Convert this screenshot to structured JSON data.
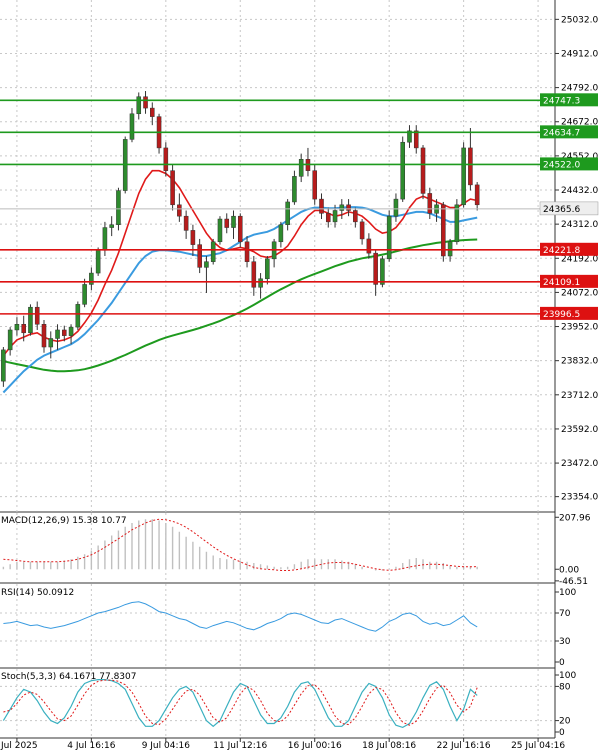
{
  "chart_data": {
    "type": "candlestick",
    "instrument_panel": {
      "price_ticks": [
        "25032.0",
        "24912.0",
        "24792.0",
        "24672.0",
        "24552.0",
        "24432.0",
        "24312.0",
        "24192.0",
        "24072.0",
        "23952.0",
        "23832.0",
        "23712.0",
        "23592.0",
        "23472.0",
        "23354.0"
      ],
      "price_tick_values": [
        25032,
        24912,
        24792,
        24672,
        24552,
        24432,
        24312,
        24192,
        24072,
        23952,
        23832,
        23712,
        23592,
        23472,
        23354
      ],
      "ylim": [
        23300,
        25100
      ],
      "levels": [
        {
          "label": "24747.3",
          "value": 24747.3,
          "color": "#1e9a1e"
        },
        {
          "label": "24634.7",
          "value": 24634.7,
          "color": "#1e9a1e"
        },
        {
          "label": "24522.0",
          "value": 24522.0,
          "color": "#1e9a1e"
        },
        {
          "label": "24221.8",
          "value": 24221.8,
          "color": "#dd1111"
        },
        {
          "label": "24109.1",
          "value": 24109.1,
          "color": "#dd1111"
        },
        {
          "label": "23996.5",
          "value": 23996.5,
          "color": "#dd1111"
        }
      ],
      "current_price": {
        "label": "24365.6",
        "value": 24365.6
      },
      "candles": [
        [
          23760,
          23880,
          23740,
          23870
        ],
        [
          23870,
          23950,
          23850,
          23940
        ],
        [
          23940,
          23985,
          23920,
          23960
        ],
        [
          23960,
          23990,
          23900,
          23930
        ],
        [
          23930,
          24030,
          23920,
          24020
        ],
        [
          24020,
          24040,
          23940,
          23960
        ],
        [
          23960,
          23975,
          23860,
          23880
        ],
        [
          23880,
          23935,
          23840,
          23910
        ],
        [
          23910,
          23960,
          23870,
          23940
        ],
        [
          23940,
          23955,
          23900,
          23920
        ],
        [
          23920,
          23960,
          23890,
          23950
        ],
        [
          23950,
          24040,
          23940,
          24030
        ],
        [
          24030,
          24120,
          24020,
          24100
        ],
        [
          24100,
          24160,
          24080,
          24140
        ],
        [
          24140,
          24230,
          24130,
          24220
        ],
        [
          24220,
          24320,
          24200,
          24300
        ],
        [
          24300,
          24340,
          24270,
          24310
        ],
        [
          24310,
          24440,
          24290,
          24430
        ],
        [
          24430,
          24620,
          24420,
          24610
        ],
        [
          24610,
          24720,
          24600,
          24700
        ],
        [
          24700,
          24775,
          24680,
          24760
        ],
        [
          24760,
          24780,
          24700,
          24720
        ],
        [
          24720,
          24740,
          24660,
          24690
        ],
        [
          24690,
          24700,
          24560,
          24580
        ],
        [
          24580,
          24600,
          24480,
          24500
        ],
        [
          24500,
          24520,
          24360,
          24380
        ],
        [
          24380,
          24420,
          24320,
          24340
        ],
        [
          24340,
          24360,
          24260,
          24290
        ],
        [
          24290,
          24310,
          24200,
          24240
        ],
        [
          24240,
          24260,
          24140,
          24160
        ],
        [
          24160,
          24200,
          24070,
          24180
        ],
        [
          24180,
          24260,
          24170,
          24250
        ],
        [
          24250,
          24340,
          24240,
          24330
        ],
        [
          24330,
          24350,
          24280,
          24300
        ],
        [
          24300,
          24360,
          24260,
          24340
        ],
        [
          24340,
          24350,
          24230,
          24250
        ],
        [
          24250,
          24270,
          24160,
          24180
        ],
        [
          24180,
          24200,
          24060,
          24090
        ],
        [
          24090,
          24140,
          24050,
          24120
        ],
        [
          24120,
          24200,
          24100,
          24190
        ],
        [
          24190,
          24260,
          24160,
          24250
        ],
        [
          24250,
          24320,
          24230,
          24310
        ],
        [
          24310,
          24400,
          24290,
          24390
        ],
        [
          24390,
          24500,
          24380,
          24480
        ],
        [
          24480,
          24560,
          24460,
          24540
        ],
        [
          24540,
          24580,
          24480,
          24500
        ],
        [
          24500,
          24520,
          24380,
          24400
        ],
        [
          24400,
          24420,
          24330,
          24350
        ],
        [
          24350,
          24370,
          24300,
          24320
        ],
        [
          24320,
          24380,
          24300,
          24360
        ],
        [
          24360,
          24400,
          24330,
          24380
        ],
        [
          24380,
          24400,
          24340,
          24360
        ],
        [
          24360,
          24370,
          24300,
          24320
        ],
        [
          24320,
          24330,
          24240,
          24260
        ],
        [
          24260,
          24280,
          24190,
          24210
        ],
        [
          24210,
          24220,
          24060,
          24100
        ],
        [
          24100,
          24200,
          24090,
          24190
        ],
        [
          24190,
          24360,
          24180,
          24340
        ],
        [
          24340,
          24420,
          24320,
          24400
        ],
        [
          24400,
          24620,
          24390,
          24600
        ],
        [
          24600,
          24660,
          24580,
          24640
        ],
        [
          24640,
          24660,
          24560,
          24580
        ],
        [
          24580,
          24590,
          24400,
          24420
        ],
        [
          24420,
          24440,
          24330,
          24350
        ],
        [
          24350,
          24400,
          24320,
          24380
        ],
        [
          24380,
          24390,
          24180,
          24200
        ],
        [
          24200,
          24260,
          24180,
          24250
        ],
        [
          24250,
          24400,
          24240,
          24380
        ],
        [
          24380,
          24600,
          24370,
          24580
        ],
        [
          24580,
          24650,
          24430,
          24450
        ],
        [
          24450,
          24460,
          24360,
          24380
        ]
      ],
      "ma_fast": [
        23850,
        23880,
        23905,
        23915,
        23925,
        23930,
        23915,
        23905,
        23900,
        23905,
        23915,
        23935,
        23965,
        24000,
        24045,
        24100,
        24150,
        24210,
        24280,
        24350,
        24420,
        24470,
        24500,
        24500,
        24490,
        24470,
        24440,
        24400,
        24360,
        24320,
        24280,
        24250,
        24230,
        24220,
        24225,
        24230,
        24225,
        24215,
        24200,
        24195,
        24200,
        24215,
        24235,
        24270,
        24310,
        24340,
        24360,
        24360,
        24350,
        24340,
        24345,
        24355,
        24350,
        24340,
        24320,
        24295,
        24280,
        24285,
        24300,
        24330,
        24370,
        24400,
        24410,
        24400,
        24390,
        24380,
        24370,
        24370,
        24385,
        24400,
        24395
      ],
      "ma_mid": [
        23720,
        23745,
        23770,
        23795,
        23815,
        23835,
        23850,
        23860,
        23870,
        23880,
        23890,
        23905,
        23925,
        23950,
        23975,
        24005,
        24035,
        24070,
        24105,
        24140,
        24175,
        24200,
        24215,
        24220,
        24220,
        24218,
        24215,
        24210,
        24205,
        24200,
        24200,
        24205,
        24210,
        24220,
        24235,
        24250,
        24265,
        24275,
        24280,
        24285,
        24295,
        24310,
        24325,
        24340,
        24355,
        24365,
        24370,
        24370,
        24368,
        24368,
        24370,
        24372,
        24372,
        24370,
        24365,
        24355,
        24345,
        24340,
        24340,
        24345,
        24350,
        24355,
        24355,
        24350,
        24340,
        24330,
        24320,
        24320,
        24325,
        24330,
        24335
      ],
      "ma_slow": [
        23830,
        23825,
        23820,
        23815,
        23810,
        23805,
        23800,
        23797,
        23795,
        23795,
        23796,
        23798,
        23802,
        23808,
        23815,
        23823,
        23832,
        23842,
        23852,
        23863,
        23874,
        23885,
        23895,
        23905,
        23913,
        23920,
        23927,
        23933,
        23940,
        23947,
        23955,
        23963,
        23972,
        23982,
        23992,
        24003,
        24015,
        24028,
        24042,
        24056,
        24070,
        24083,
        24095,
        24107,
        24118,
        24128,
        24137,
        24146,
        24155,
        24164,
        24172,
        24180,
        24186,
        24192,
        24196,
        24200,
        24205,
        24210,
        24216,
        24222,
        24228,
        24233,
        24238,
        24242,
        24246,
        24249,
        24252,
        24254,
        24256,
        24257,
        24258
      ]
    },
    "x_ticks": [
      "Jul 2025",
      "4 Jul 16:16",
      "9 Jul 04:16",
      "11 Jul 12:16",
      "16 Jul 00:16",
      "18 Jul 08:16",
      "22 Jul 16:16",
      "25 Jul 04:16"
    ],
    "x_tick_index": [
      2,
      13,
      24,
      35,
      46,
      57,
      68,
      79
    ],
    "macd_panel": {
      "label": "MACD(12,26,9) 15.38 10.77",
      "ticks": [
        "207.96",
        "0.00",
        "-46.51"
      ],
      "tick_values": [
        207.96,
        0,
        -46.51
      ],
      "ylim": [
        -55,
        225
      ],
      "histogram": [
        10,
        20,
        30,
        30,
        30,
        30,
        30,
        30,
        30,
        35,
        40,
        50,
        60,
        75,
        95,
        115,
        135,
        155,
        170,
        185,
        195,
        200,
        200,
        195,
        185,
        170,
        150,
        130,
        110,
        90,
        70,
        55,
        45,
        40,
        38,
        35,
        30,
        25,
        20,
        15,
        10,
        8,
        10,
        20,
        30,
        40,
        40,
        40,
        40,
        40,
        35,
        30,
        20,
        10,
        0,
        -5,
        -5,
        0,
        10,
        25,
        40,
        45,
        40,
        30,
        30,
        25,
        15,
        10,
        12,
        12,
        10
      ],
      "signal": [
        40,
        38,
        35,
        32,
        30,
        30,
        30,
        30,
        30,
        32,
        35,
        40,
        48,
        58,
        72,
        88,
        105,
        122,
        140,
        158,
        172,
        185,
        195,
        200,
        198,
        192,
        182,
        168,
        150,
        130,
        110,
        90,
        72,
        56,
        42,
        30,
        18,
        8,
        2,
        0,
        -2,
        -5,
        -5,
        -3,
        2,
        8,
        14,
        20,
        25,
        27,
        27,
        25,
        20,
        14,
        8,
        2,
        -2,
        -4,
        -2,
        3,
        9,
        14,
        18,
        20,
        20,
        18,
        15,
        12,
        10,
        10,
        10.77
      ]
    },
    "rsi_panel": {
      "label": "RSI(14) 50.0912",
      "ticks": [
        "100",
        "70",
        "30",
        "0"
      ],
      "tick_values": [
        100,
        70,
        30,
        0
      ],
      "ylim": [
        0,
        100
      ],
      "values": [
        55,
        56,
        58,
        55,
        52,
        53,
        50,
        48,
        50,
        52,
        55,
        58,
        62,
        66,
        70,
        72,
        75,
        78,
        82,
        85,
        86,
        83,
        78,
        72,
        70,
        66,
        62,
        60,
        55,
        50,
        48,
        52,
        55,
        58,
        56,
        52,
        48,
        46,
        50,
        55,
        58,
        62,
        68,
        70,
        68,
        64,
        60,
        56,
        55,
        60,
        62,
        58,
        54,
        50,
        46,
        44,
        50,
        58,
        62,
        68,
        70,
        66,
        58,
        54,
        56,
        52,
        54,
        60,
        66,
        56,
        50.09
      ]
    },
    "stoch_panel": {
      "label": "Stoch(5,3,3) 64.1671 77.8307",
      "ticks": [
        "100",
        "80",
        "20",
        "0"
      ],
      "tick_values": [
        100,
        80,
        20,
        0
      ],
      "ylim": [
        0,
        100
      ],
      "k": [
        20,
        40,
        60,
        75,
        70,
        55,
        35,
        20,
        15,
        25,
        45,
        70,
        85,
        90,
        92,
        92,
        90,
        85,
        75,
        50,
        25,
        10,
        10,
        20,
        40,
        60,
        75,
        80,
        70,
        45,
        20,
        10,
        20,
        45,
        70,
        85,
        80,
        55,
        30,
        15,
        15,
        25,
        45,
        70,
        85,
        88,
        75,
        50,
        25,
        10,
        10,
        20,
        45,
        70,
        85,
        80,
        60,
        30,
        12,
        8,
        15,
        35,
        60,
        82,
        88,
        75,
        45,
        20,
        40,
        75,
        64.17
      ],
      "d": [
        35,
        38,
        50,
        65,
        70,
        66,
        53,
        37,
        23,
        20,
        28,
        47,
        67,
        82,
        89,
        91,
        91,
        89,
        83,
        70,
        50,
        28,
        15,
        13,
        23,
        40,
        58,
        72,
        75,
        65,
        45,
        25,
        17,
        25,
        45,
        67,
        80,
        73,
        55,
        33,
        20,
        18,
        28,
        47,
        67,
        81,
        83,
        71,
        50,
        28,
        15,
        13,
        25,
        45,
        67,
        78,
        75,
        57,
        34,
        17,
        12,
        19,
        37,
        59,
        77,
        82,
        69,
        47,
        35,
        45,
        77.83
      ]
    }
  }
}
